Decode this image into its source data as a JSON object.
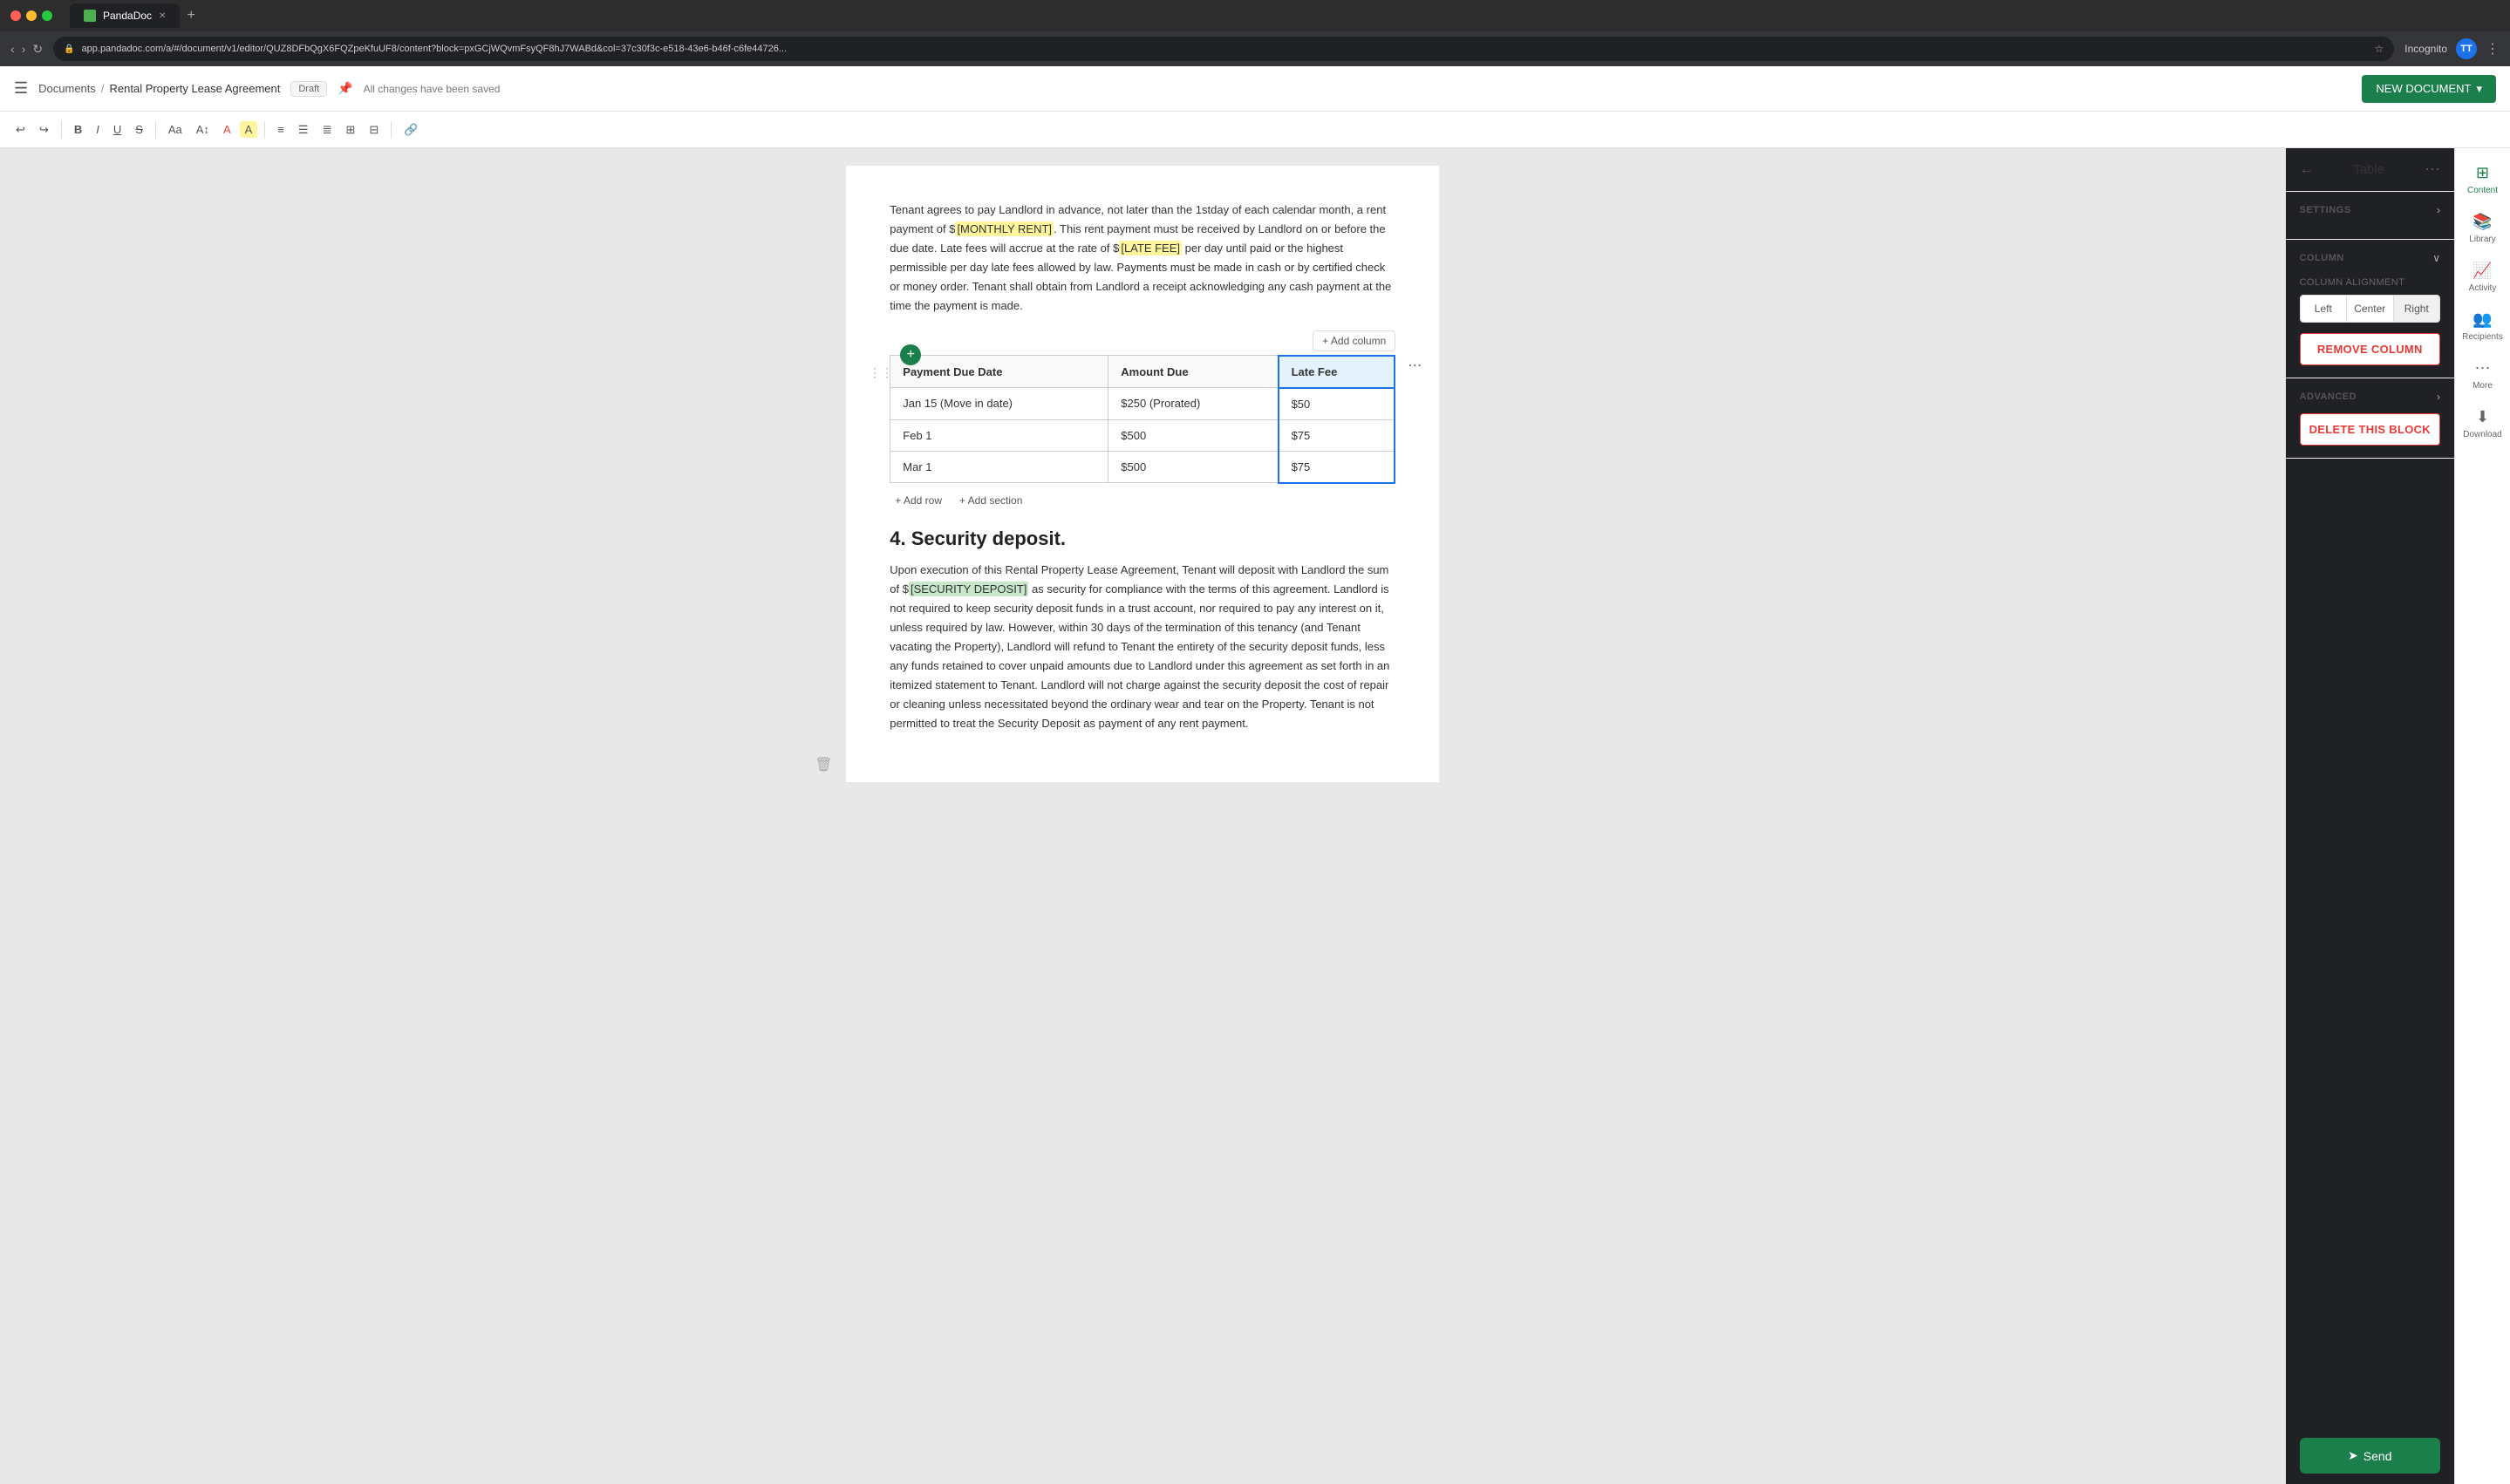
{
  "titlebar": {
    "tab_label": "PandaDoc",
    "new_tab_icon": "+"
  },
  "urlbar": {
    "url": "app.pandadoc.com/a/#/document/v1/editor/QUZ8DFbQgX6FQZpeKfuUF8/content?block=pxGCjWQvmFsyQF8hJ7WABd&col=37c30f3c-e518-43e6-b46f-c6fe44726...",
    "incognito_label": "Incognito",
    "avatar_label": "TT"
  },
  "topbar": {
    "breadcrumb_documents": "Documents",
    "breadcrumb_sep": "/",
    "breadcrumb_doc": "Rental Property Lease Agreement",
    "draft_label": "Draft",
    "saved_label": "All changes have been saved",
    "new_document_label": "NEW DOCUMENT"
  },
  "toolbar": {
    "buttons": [
      "↩",
      "↪",
      "B",
      "I",
      "U",
      "S",
      "Aa",
      "A↕",
      "A",
      "A",
      "≡",
      "☰",
      "≣",
      "⊞",
      "⬡"
    ]
  },
  "document": {
    "paragraph1": "Tenant agrees to pay Landlord in advance, not later than the 1stday of each calendar month, a rent payment of $",
    "highlight_monthly": "[MONTHLY RENT]",
    "paragraph1b": ". This rent payment must be received by Landlord on or before the due date. Late fees will accrue at the rate of $",
    "highlight_late": "[LATE FEE]",
    "paragraph1c": " per day until paid or the highest permissible per day late fees allowed by law. Payments must be made in cash or by certified check or money order. Tenant shall obtain from Landlord a receipt acknowledging any cash payment at the time the payment is made.",
    "table": {
      "columns": [
        "Payment Due Date",
        "Amount Due",
        "Late Fee"
      ],
      "rows": [
        [
          "Jan 15 (Move in date)",
          "$250 (Prorated)",
          "$50"
        ],
        [
          "Feb 1",
          "$500",
          "$75"
        ],
        [
          "Mar 1",
          "$500",
          "$75"
        ]
      ],
      "add_column_label": "+ Add column",
      "add_row_label": "+ Add row",
      "add_section_label": "+ Add section"
    },
    "section4_heading": "4. Security deposit.",
    "paragraph2": "Upon execution of this Rental Property Lease Agreement, Tenant will deposit with Landlord the sum of $",
    "highlight_security": "[SECURITY DEPOSIT]",
    "paragraph2b": " as security for compliance with the terms of this agreement. Landlord is not required to keep security deposit funds in a trust account, nor required to pay any interest on it, unless required by law. However, within 30 days of the termination of this tenancy (and Tenant vacating the Property), Landlord will refund to Tenant the entirety of the security deposit funds, less any funds retained to cover unpaid amounts due to Landlord under this agreement as set forth in an itemized statement to Tenant. Landlord will not charge against the security deposit the cost of repair or cleaning unless necessitated beyond the ordinary wear and tear on the Property. Tenant is not permitted to treat the Security Deposit as payment of any rent payment."
  },
  "right_panel": {
    "title": "Table",
    "back_icon": "←",
    "more_icon": "⋯",
    "settings_label": "SETTINGS",
    "column_label": "COLUMN",
    "column_alignment_label": "COLUMN ALIGNMENT",
    "align_left": "Left",
    "align_center": "Center",
    "align_right": "Right",
    "remove_column_label": "REMOVE COLUMN",
    "advanced_label": "ADVANCED",
    "delete_block_label": "DELETE THIS BLOCK",
    "send_label": "Send"
  },
  "side_icons": [
    {
      "icon": "⊞",
      "label": "Content",
      "active": false
    },
    {
      "icon": "📚",
      "label": "Library",
      "active": false
    },
    {
      "icon": "📈",
      "label": "Activity",
      "active": false
    },
    {
      "icon": "👥",
      "label": "Recipients",
      "active": false
    },
    {
      "icon": "⋯",
      "label": "More",
      "active": false
    },
    {
      "icon": "⬇",
      "label": "Download",
      "active": false
    }
  ]
}
